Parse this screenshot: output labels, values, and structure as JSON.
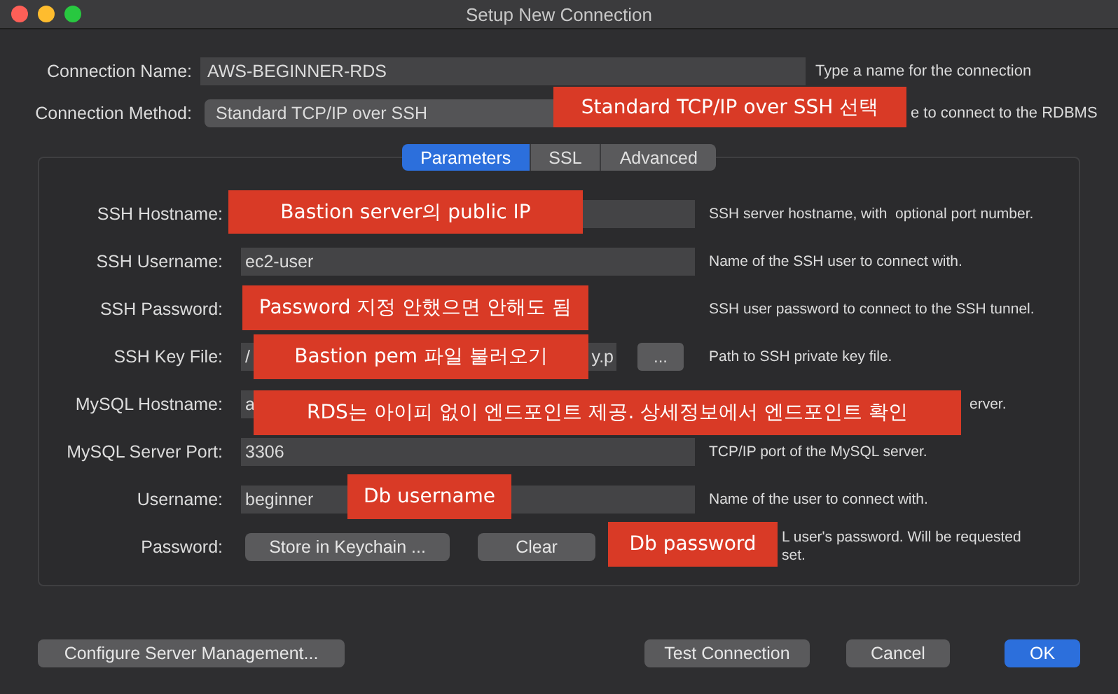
{
  "window": {
    "title": "Setup New Connection"
  },
  "connection_name": {
    "label": "Connection Name:",
    "value": "AWS-BEGINNER-RDS",
    "help": "Type a name for the connection"
  },
  "connection_method": {
    "label": "Connection Method:",
    "value": "Standard TCP/IP over SSH",
    "help": "e to connect to the RDBMS",
    "help_cut": true
  },
  "tabs": [
    {
      "label": "Parameters",
      "selected": true
    },
    {
      "label": "SSL",
      "selected": false
    },
    {
      "label": "Advanced",
      "selected": false
    }
  ],
  "fields": [
    {
      "kind": "text",
      "label": "SSH Hostname:",
      "help": "SSH server hostname, with  optional port number."
    },
    {
      "kind": "text",
      "label": "SSH Username:",
      "value": "ec2-user",
      "help": "Name of the SSH user to connect with."
    },
    {
      "kind": "password",
      "label": "SSH Password:",
      "help": "SSH user password to connect to the SSH tunnel."
    },
    {
      "kind": "file",
      "label": "SSH Key File:",
      "value_start": "/",
      "value_end": "y.p",
      "browse": "...",
      "help": "Path to SSH private key file."
    },
    {
      "kind": "text",
      "label": "MySQL Hostname:",
      "value": "a",
      "help": "erver.",
      "help_cut": true
    },
    {
      "kind": "text",
      "label": "MySQL Server Port:",
      "value": "3306",
      "help": "TCP/IP port of the MySQL server."
    },
    {
      "kind": "text",
      "label": "Username:",
      "value": "beginner",
      "help": "Name of the user to connect with."
    },
    {
      "kind": "buttons",
      "label": "Password:",
      "buttons": [
        "Store in Keychain ...",
        "Clear"
      ],
      "help": "L user's password. Will be requested\nset.",
      "help_cut": true
    }
  ],
  "callouts": [
    "Standard TCP/IP over SSH 선택",
    "Bastion server의 public IP",
    "Password 지정 안했으면 안해도 됨",
    "Bastion pem 파일 불러오기",
    "RDS는 아이피 없이 엔드포인트 제공. 상세정보에서 엔드포인트 확인",
    "Db username",
    "Db password"
  ],
  "footer": {
    "left": "Configure Server Management...",
    "buttons": [
      {
        "label": "Test Connection",
        "kind": "normal"
      },
      {
        "label": "Cancel",
        "kind": "normal"
      },
      {
        "label": "OK",
        "kind": "default"
      }
    ]
  }
}
